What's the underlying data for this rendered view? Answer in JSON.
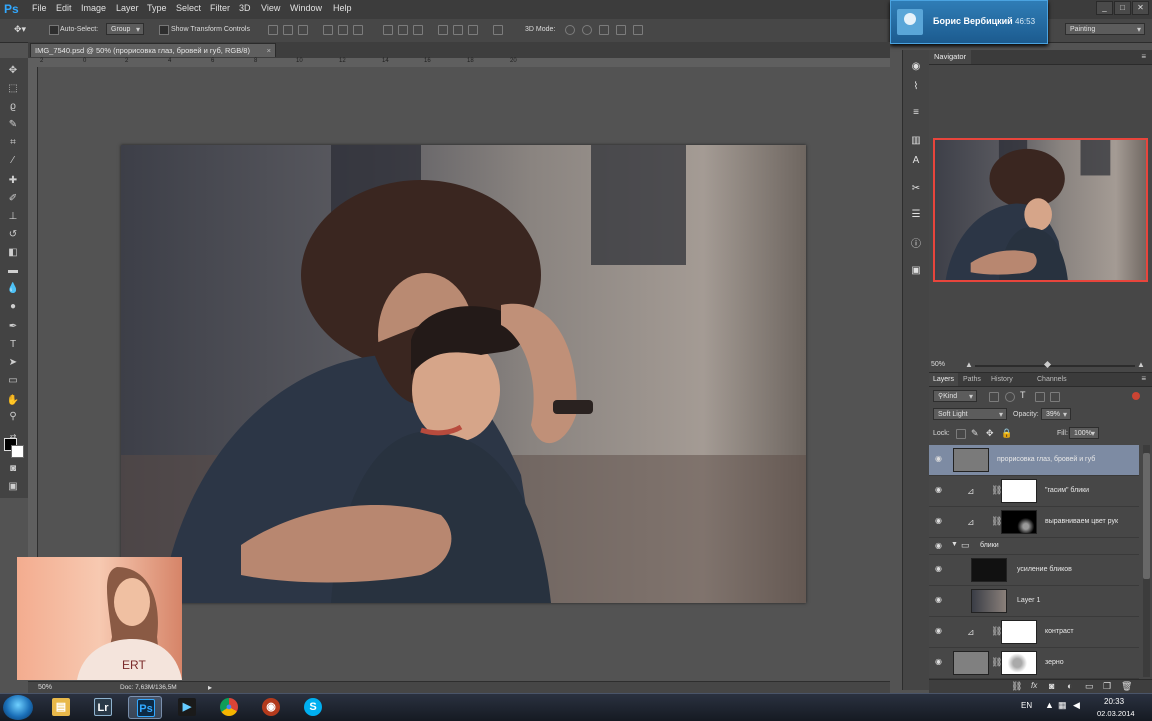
{
  "app": {
    "logo": "Ps"
  },
  "menu": [
    "File",
    "Edit",
    "Image",
    "Layer",
    "Type",
    "Select",
    "Filter",
    "3D",
    "View",
    "Window",
    "Help"
  ],
  "notification": {
    "name": "Борис Вербицкий",
    "time": "46:53"
  },
  "window_controls": [
    "_",
    "□",
    "✕"
  ],
  "options": {
    "auto_select_label": "Auto-Select:",
    "auto_select_value": "Group",
    "transform_label": "Show Transform Controls",
    "mode_3d_label": "3D Mode:",
    "workspace": "Painting"
  },
  "document": {
    "tab_title": "IMG_7540.psd @ 50% (прорисовка глаз, бровей и губ, RGB/8)",
    "close": "×"
  },
  "ruler_ticks": [
    "2",
    "0",
    "2",
    "4",
    "6",
    "8",
    "10",
    "12",
    "14",
    "16",
    "18",
    "20"
  ],
  "status": {
    "zoom": "50%",
    "doc": "Doc: 7,63M/136,5M"
  },
  "navigator": {
    "tab": "Navigator",
    "zoom": "50%"
  },
  "layers": {
    "tabs": [
      "Layers",
      "Paths",
      "History",
      "Channels"
    ],
    "kind": "Kind",
    "blend_mode": "Soft Light",
    "opacity_label": "Opacity:",
    "opacity": "39%",
    "lock_label": "Lock:",
    "fill_label": "Fill:",
    "fill": "100%",
    "items": [
      {
        "name": "прорисовка глаз, бровей и губ",
        "type": "pixel",
        "selected": true
      },
      {
        "name": "\"гасим\" блики",
        "type": "adjustment"
      },
      {
        "name": "выравниваем цвет рук",
        "type": "adjustment"
      },
      {
        "name": "блики",
        "type": "group"
      },
      {
        "name": "усиление бликов",
        "type": "pixel"
      },
      {
        "name": "Layer 1",
        "type": "pixel"
      },
      {
        "name": "контраст",
        "type": "adjustment"
      },
      {
        "name": "зерно",
        "type": "pixel"
      }
    ]
  },
  "taskbar": {
    "lang": "EN",
    "time": "20:33",
    "date": "02.03.2014",
    "apps": [
      {
        "name": "explorer",
        "glyph": "▤",
        "color": "#e8b84a"
      },
      {
        "name": "lightroom",
        "glyph": "Lr",
        "color": "#2a3a48"
      },
      {
        "name": "photoshop",
        "glyph": "Ps",
        "color": "#0e2a44"
      },
      {
        "name": "media-player",
        "glyph": "▶",
        "color": "#1a1a1a"
      },
      {
        "name": "chrome",
        "glyph": "●",
        "color": "#db4437"
      },
      {
        "name": "eye-app",
        "glyph": "◉",
        "color": "#b33a1c"
      },
      {
        "name": "skype",
        "glyph": "S",
        "color": "#00aff0"
      }
    ]
  }
}
